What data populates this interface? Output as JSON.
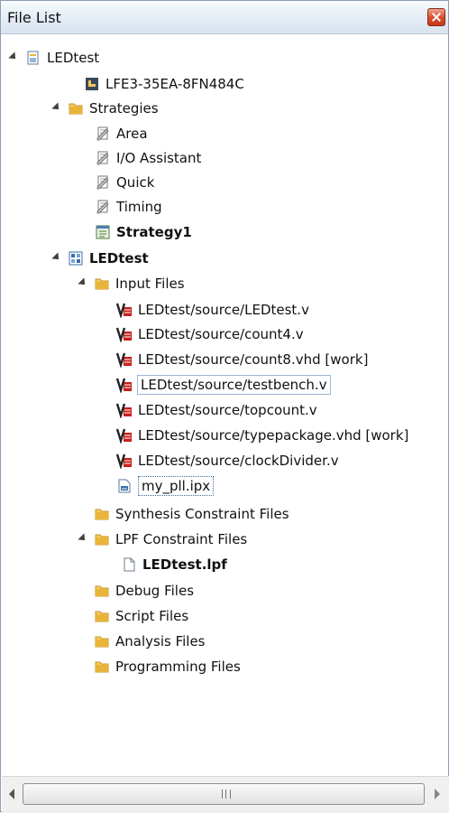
{
  "panel": {
    "title": "File List"
  },
  "tree": {
    "root_project": "LEDtest",
    "device": "LFE3-35EA-8FN484C",
    "strategies_folder": "Strategies",
    "strategies": [
      "Area",
      "I/O Assistant",
      "Quick",
      "Timing"
    ],
    "active_strategy": "Strategy1",
    "implementation": "LEDtest",
    "input_files_folder": "Input Files",
    "input_files": [
      "LEDtest/source/LEDtest.v",
      "LEDtest/source/count4.v",
      "LEDtest/source/count8.vhd [work]",
      "LEDtest/source/testbench.v",
      "LEDtest/source/topcount.v",
      "LEDtest/source/typepackage.vhd [work]",
      "LEDtest/source/clockDivider.v"
    ],
    "ipx_file": "my_pll.ipx",
    "synthesis_folder": "Synthesis Constraint Files",
    "lpf_folder": "LPF Constraint Files",
    "lpf_file": "LEDtest.lpf",
    "debug_folder": "Debug Files",
    "script_folder": "Script Files",
    "analysis_folder": "Analysis Files",
    "programming_folder": "Programming Files"
  },
  "colors": {
    "folder": "#e8b53a",
    "titlebar": "#dde7f2",
    "close": "#d8492a",
    "hdl_red": "#c8201a"
  }
}
